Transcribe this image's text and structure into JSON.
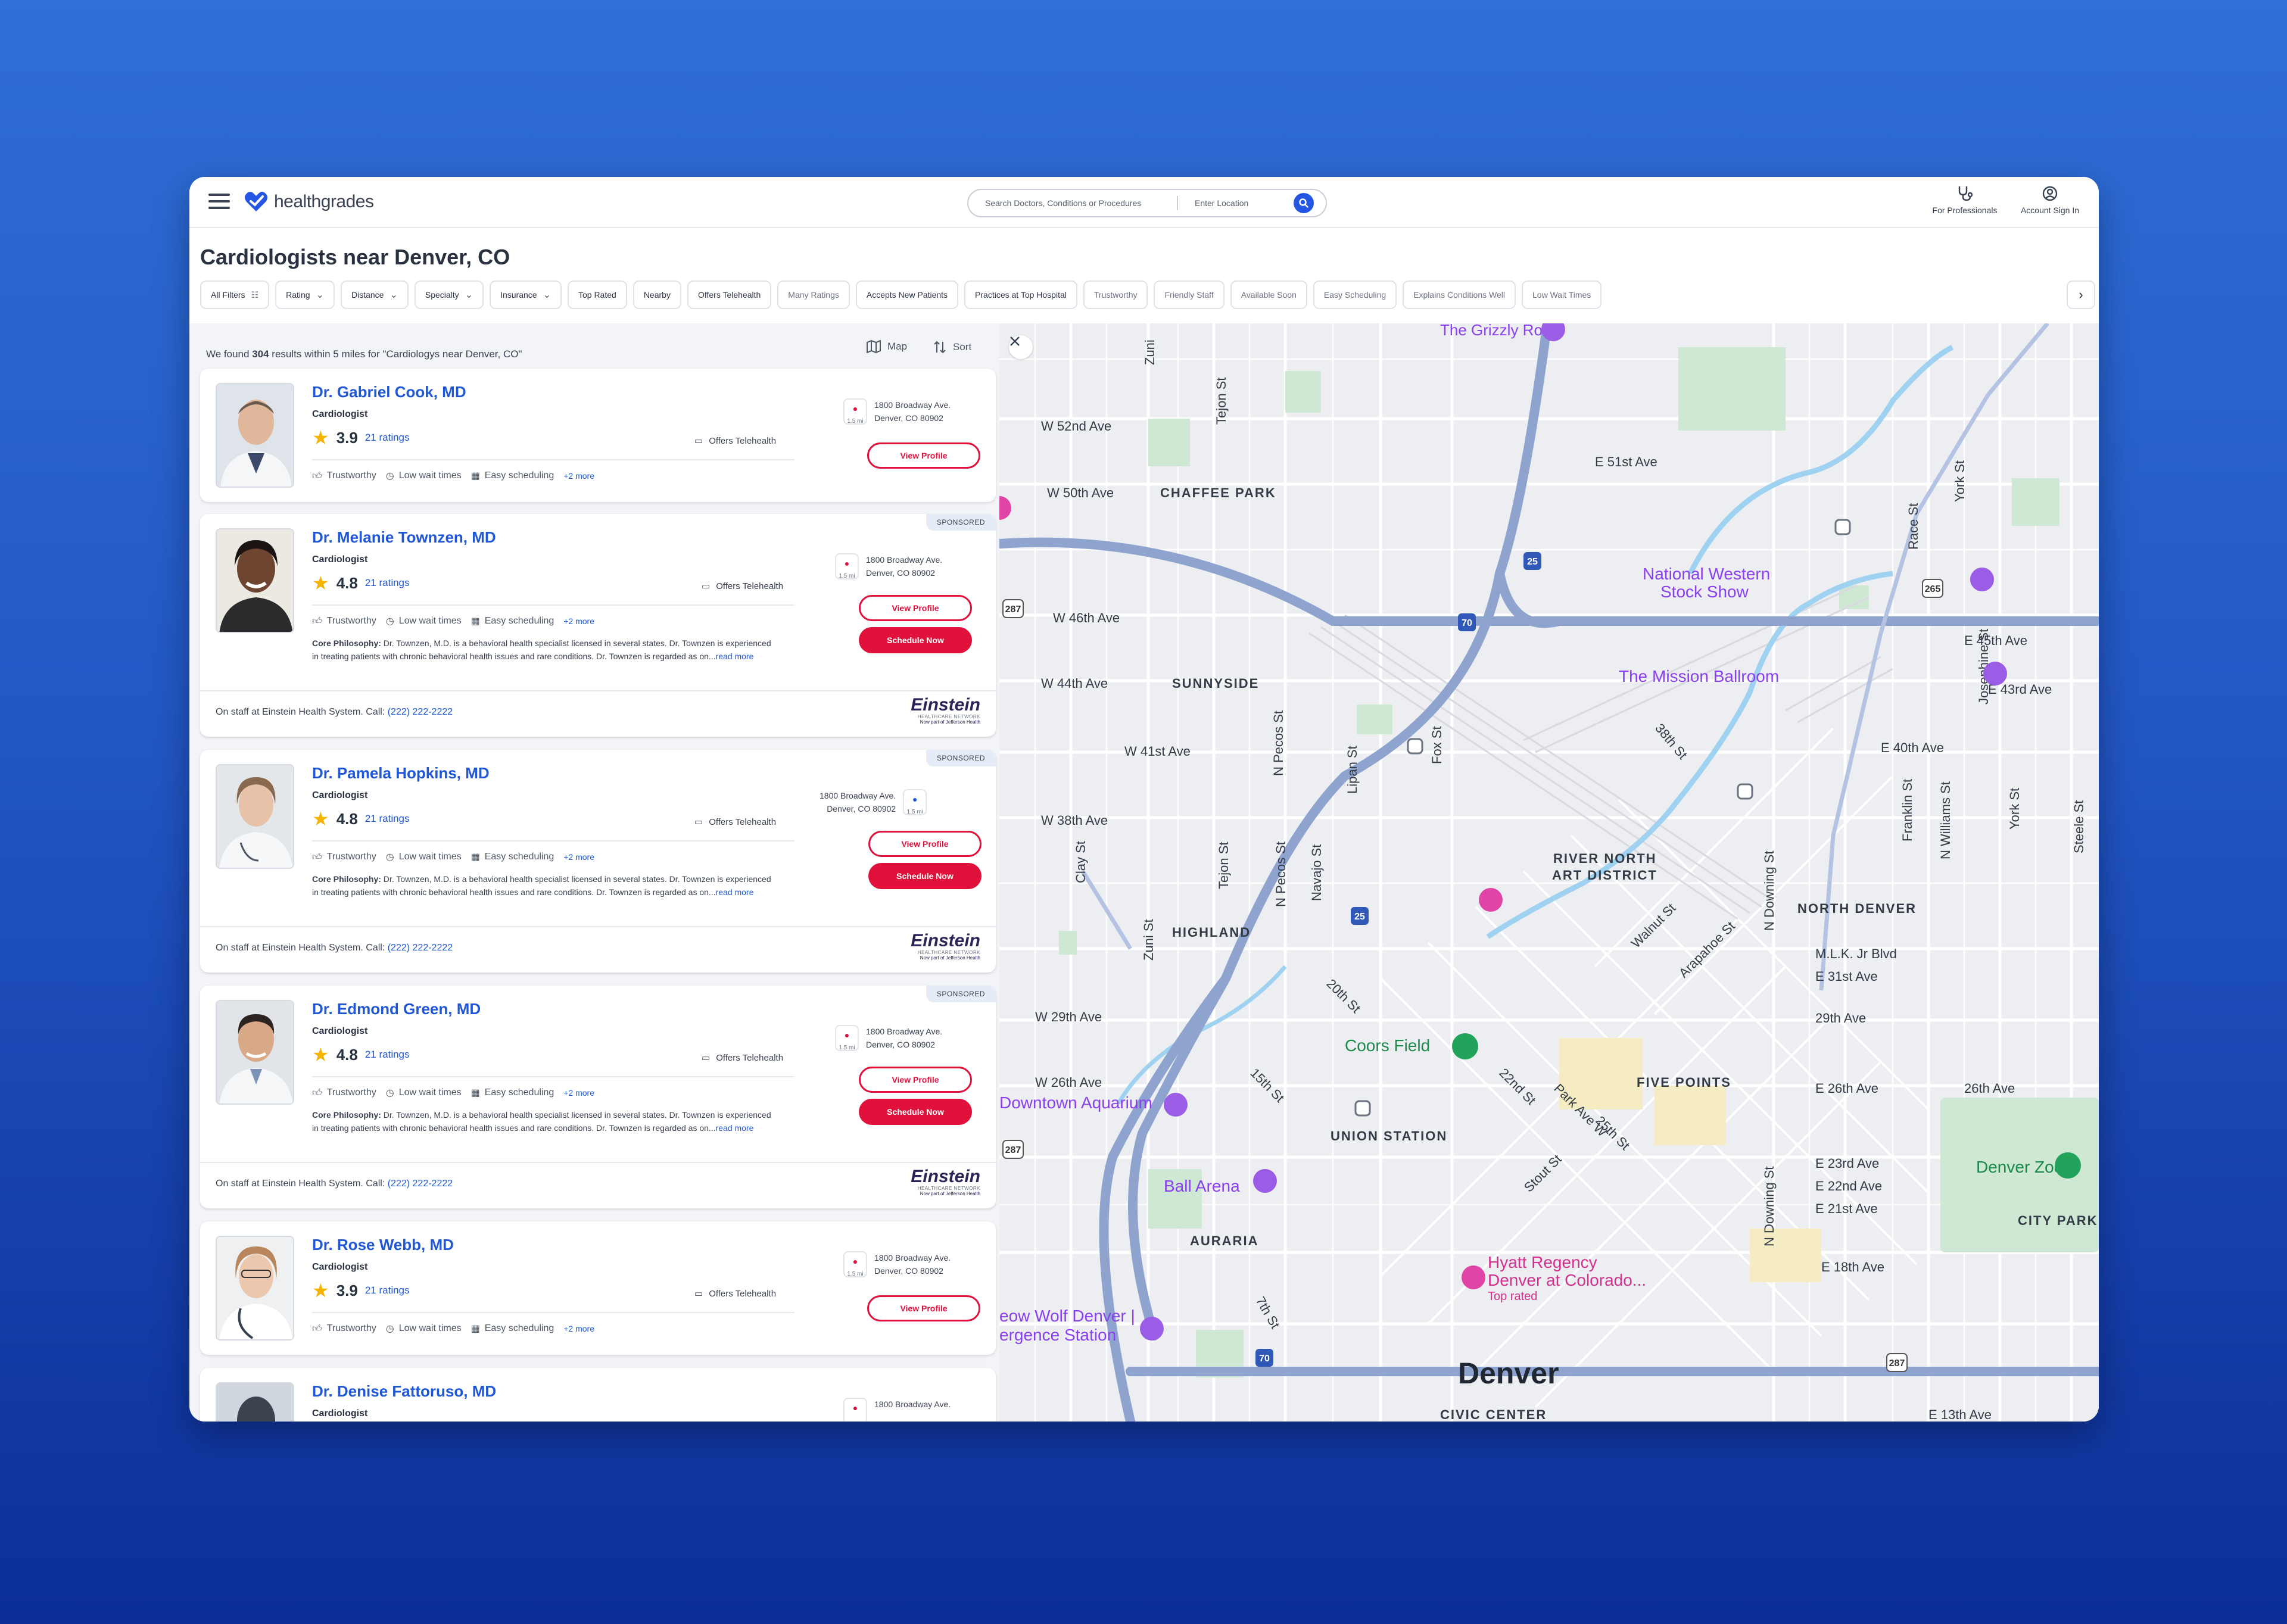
{
  "header": {
    "brand": "healthgrades",
    "search_placeholder": "Search Doctors, Conditions or Procedures",
    "location_placeholder": "Enter Location",
    "for_professionals": "For Professionals",
    "account_sign_in": "Account Sign In"
  },
  "page_title": "Cardiologists near Denver, CO",
  "filters": [
    {
      "label": "All Filters",
      "icon": "filter-icon"
    },
    {
      "label": "Rating",
      "dropdown": true
    },
    {
      "label": "Distance",
      "dropdown": true
    },
    {
      "label": "Specialty",
      "dropdown": true
    },
    {
      "label": "Insurance",
      "dropdown": true
    },
    {
      "label": "Top Rated"
    },
    {
      "label": "Nearby"
    },
    {
      "label": "Offers Telehealth"
    },
    {
      "label": "Many Ratings",
      "muted": true
    },
    {
      "label": "Accepts New Patients"
    },
    {
      "label": "Practices at Top Hospital"
    },
    {
      "label": "Trustworthy",
      "muted": true
    },
    {
      "label": "Friendly Staff",
      "muted": true
    },
    {
      "label": "Available Soon",
      "muted": true
    },
    {
      "label": "Easy Scheduling",
      "muted": true
    },
    {
      "label": "Explains Conditions Well",
      "muted": true
    },
    {
      "label": "Low Wait Times",
      "muted": true
    }
  ],
  "results": {
    "prefix": "We found ",
    "count": "304",
    "suffix": " results within 5 miles for \"Cardiologys near Denver, CO\"",
    "map_label": "Map",
    "sort_label": "Sort"
  },
  "doctors": [
    {
      "name": "Dr. Gabriel Cook, MD",
      "specialty": "Cardiologist",
      "rating": "3.9",
      "ratings_count": "21 ratings",
      "telehealth": "Offers Telehealth",
      "tags": [
        "Trustworthy",
        "Low wait times",
        "Easy scheduling"
      ],
      "more": "+2 more",
      "address_line1": "1800 Broadway Ave.",
      "address_line2": "Denver, CO 80902",
      "distance": "1.5 mi",
      "view_profile": "View Profile"
    },
    {
      "name": "Dr. Melanie Townzen, MD",
      "specialty": "Cardiologist",
      "rating": "4.8",
      "ratings_count": "21 ratings",
      "telehealth": "Offers Telehealth",
      "tags": [
        "Trustworthy",
        "Low wait times",
        "Easy scheduling"
      ],
      "more": "+2 more",
      "philosophy_label": "Core Philosophy:",
      "philosophy": " Dr. Townzen, M.D. is a behavioral health specialist licensed in several states. Dr. Townzen is experienced in treating patients with chronic behavioral health issues and rare conditions. Dr. Townzen is regarded as on...",
      "read_more": "read more",
      "address_line1": "1800 Broadway Ave.",
      "address_line2": "Denver, CO 80902",
      "distance": "1.5 mi",
      "view_profile": "View Profile",
      "schedule": "Schedule Now",
      "sponsored": "SPONSORED",
      "staff_text": "On staff at Einstein Health System. Call: ",
      "staff_phone": "(222) 222-2222"
    },
    {
      "name": "Dr. Pamela Hopkins, MD",
      "specialty": "Cardiologist",
      "rating": "4.8",
      "ratings_count": "21 ratings",
      "telehealth": "Offers Telehealth",
      "tags": [
        "Trustworthy",
        "Low wait times",
        "Easy scheduling"
      ],
      "more": "+2 more",
      "philosophy_label": "Core Philosophy:",
      "philosophy": " Dr. Townzen, M.D. is a behavioral health specialist licensed in several states. Dr. Townzen is experienced in treating patients with chronic behavioral health issues and rare conditions. Dr. Townzen is regarded as on...",
      "read_more": "read more",
      "address_line1": "1800 Broadway Ave.",
      "address_line2": "Denver, CO 80902",
      "distance": "1.5 mi",
      "view_profile": "View Profile",
      "schedule": "Schedule Now",
      "sponsored": "SPONSORED",
      "staff_text": "On staff at Einstein Health System. Call: ",
      "staff_phone": "(222) 222-2222"
    },
    {
      "name": "Dr. Edmond Green, MD",
      "specialty": "Cardiologist",
      "rating": "4.8",
      "ratings_count": "21 ratings",
      "telehealth": "Offers Telehealth",
      "tags": [
        "Trustworthy",
        "Low wait times",
        "Easy scheduling"
      ],
      "more": "+2 more",
      "philosophy_label": "Core Philosophy:",
      "philosophy": " Dr. Townzen, M.D. is a behavioral health specialist licensed in several states. Dr. Townzen is experienced in treating patients with chronic behavioral health issues and rare conditions. Dr. Townzen is regarded as on...",
      "read_more": "read more",
      "address_line1": "1800 Broadway Ave.",
      "address_line2": "Denver, CO 80902",
      "distance": "1.5 mi",
      "view_profile": "View Profile",
      "schedule": "Schedule Now",
      "sponsored": "SPONSORED",
      "staff_text": "On staff at Einstein Health System. Call: ",
      "staff_phone": "(222) 222-2222"
    },
    {
      "name": "Dr. Rose Webb, MD",
      "specialty": "Cardiologist",
      "rating": "3.9",
      "ratings_count": "21 ratings",
      "telehealth": "Offers Telehealth",
      "tags": [
        "Trustworthy",
        "Low wait times",
        "Easy scheduling"
      ],
      "more": "+2 more",
      "address_line1": "1800 Broadway Ave.",
      "address_line2": "Denver, CO 80902",
      "distance": "1.5 mi",
      "view_profile": "View Profile"
    },
    {
      "name": "Dr. Denise Fattoruso, MD",
      "specialty": "Cardiologist",
      "address_line1": "1800 Broadway Ave."
    }
  ],
  "hospital_logo": {
    "name": "Einstein",
    "line2": "HEALTHCARE NETWORK",
    "line3": "Now part of Jefferson Health"
  },
  "map": {
    "labels": {
      "grizzly_rose": "The Grizzly Rose",
      "w52": "W 52nd Ave",
      "w50": "W 50th Ave",
      "chaffee": "CHAFFEE PARK",
      "e51": "E 51st Ave",
      "nw_stock": "National Western",
      "nw_stock2": "Stock Show",
      "w46": "W 46th Ave",
      "e45": "E 45th Ave",
      "mission": "The Mission Ballroom",
      "e43": "E 43rd Ave",
      "w44": "W 44th Ave",
      "sunnyside": "SUNNYSIDE",
      "w41": "W 41st Ave",
      "e40": "E 40th Ave",
      "w38": "W 38th Ave",
      "rino": "RIVER NORTH",
      "rino2": "ART DISTRICT",
      "north_denver": "NORTH DENVER",
      "highland": "HIGHLAND",
      "mlk": "M.L.K. Jr Blvd",
      "e31": "E 31st Ave",
      "w29": "W 29th Ave",
      "av29": "29th Ave",
      "coors": "Coors Field",
      "w26": "W 26th Ave",
      "five_points": "FIVE POINTS",
      "e26": "E 26th Ave",
      "av26": "26th Ave",
      "aquarium": "Downtown Aquarium",
      "union": "UNION STATION",
      "ball": "Ball Arena",
      "e23": "E 23rd Ave",
      "e22": "E 22nd Ave",
      "e21": "E 21st Ave",
      "zoo": "Denver Zoo",
      "city_park": "CITY PARK",
      "auraria": "AURARIA",
      "hyatt1": "Hyatt Regency",
      "hyatt2": "Denver at Colorado...",
      "top_rated": "Top rated",
      "e18": "E 18th Ave",
      "meow1": "eow Wolf Denver |",
      "meow2": "ergence Station",
      "denver": "Denver",
      "civic": "CIVIC CENTER",
      "e13": "E 13th Ave",
      "zuni": "Zuni",
      "tejon": "Tejon St",
      "york": "York St",
      "race": "Race St",
      "josephine": "Josephine St",
      "n_pecos": "N Pecos St",
      "lipan": "Lipan St",
      "fox": "Fox St",
      "st38": "38th St",
      "franklin": "Franklin St",
      "n_williams": "N Williams St",
      "york2": "York St",
      "steele": "Steele St",
      "clay": "Clay St",
      "tejon2": "Tejon St",
      "n_pecos2": "N Pecos St",
      "navajo": "Navajo St",
      "walnut": "Walnut St",
      "arapahoe": "Arapahoe St",
      "n_downing": "N Downing St",
      "zuni2": "Zuni St",
      "st20": "20th St",
      "st22": "22nd St",
      "park_ave": "Park Ave W",
      "st25": "25th St",
      "st15": "15th St",
      "stout": "Stout St",
      "n_downing2": "N Downing St",
      "st7": "7th St",
      "i25": "25",
      "i70": "70",
      "r287": "287",
      "r265": "265"
    }
  }
}
